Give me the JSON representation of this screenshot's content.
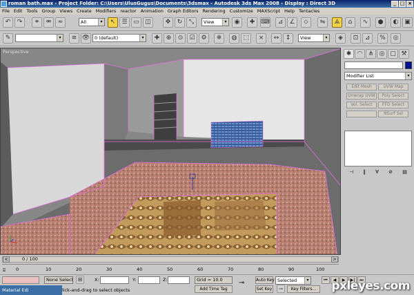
{
  "window": {
    "title": "roman bath.max   - Project Folder: C:\\Users\\UlusGugus\\Documents\\3dsmax   - Autodesk 3ds Max 2008     - Display : Direct 3D",
    "controls": [
      "_",
      "□",
      "×"
    ]
  },
  "menu": [
    "File",
    "Edit",
    "Tools",
    "Group",
    "Views",
    "Create",
    "Modifiers",
    "reactor",
    "Animation",
    "Graph Editors",
    "Rendering",
    "Customize",
    "MAXScript",
    "Help",
    "Tentacles"
  ],
  "toolbar1": {
    "selection_filter": "All",
    "ref_coord": "View",
    "named_selection": ""
  },
  "toolbar2": {
    "layer": "0 (default)",
    "ref_coord": "View"
  },
  "viewport": {
    "label": "Perspective"
  },
  "command_panel": {
    "name_field": "",
    "color_swatch": "#00108c",
    "modifier_list": "Modifier List",
    "buttons": [
      "Edit Mesh",
      "UVW Map",
      "Unwrap UVW",
      "Poly Select",
      "Vol. Select",
      "FFD Select",
      "",
      "NSurf Sel"
    ]
  },
  "timeline": {
    "frame_display": "0 / 100",
    "ticks": [
      "0",
      "10",
      "20",
      "30",
      "40",
      "50",
      "60",
      "70",
      "80",
      "90",
      "100"
    ]
  },
  "status": {
    "selection": "None Selecte",
    "prompt": "lick-and-drag to select objects",
    "x_label": "X:",
    "y_label": "Y:",
    "z_label": "Z:",
    "x": "",
    "y": "",
    "z": "",
    "grid": "Grid = 10.0",
    "add_time_tag": "Add Time Tag",
    "auto_key": "Auto Key",
    "set_key": "Set Key",
    "key_mode": "Selected",
    "key_filters": "Key Filters...",
    "taskbar_item": "Material Edi"
  },
  "watermark": "pxleyes.com",
  "colors": {
    "selection_pink": "#e070e0",
    "key_active": "#f4d24a"
  }
}
